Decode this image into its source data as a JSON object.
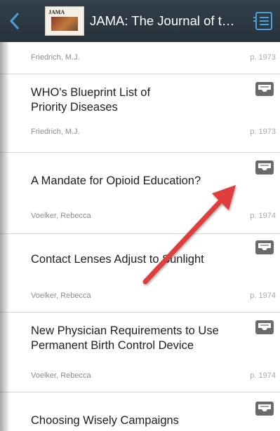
{
  "navbar": {
    "title": "JAMA: The Journal of t…",
    "cover_label": "JAMA",
    "back_icon": "chevron-left-icon",
    "toc_icon": "table-of-contents-icon"
  },
  "articles": [
    {
      "title": "",
      "author": "Friedrich, M.J.",
      "page": "p. 1973"
    },
    {
      "title": "WHO's Blueprint List of Priority Diseases",
      "author": "Friedrich, M.J.",
      "page": "p. 1973"
    },
    {
      "title": "A Mandate for Opioid Education?",
      "author": "Voelker, Rebecca",
      "page": "p. 1974"
    },
    {
      "title": "Contact Lenses Adjust to Sunlight",
      "author": "Voelker, Rebecca",
      "page": "p. 1974"
    },
    {
      "title": "New Physician Requirements to Use Permanent Birth Control Device",
      "author": "Voelker, Rebecca",
      "page": "p. 1974"
    },
    {
      "title": "Choosing Wisely Campaigns",
      "author": "",
      "page": ""
    }
  ],
  "colors": {
    "navbar": "#2c3843",
    "accent": "#4aa3d8",
    "annotation_arrow": "#e03c3c"
  }
}
